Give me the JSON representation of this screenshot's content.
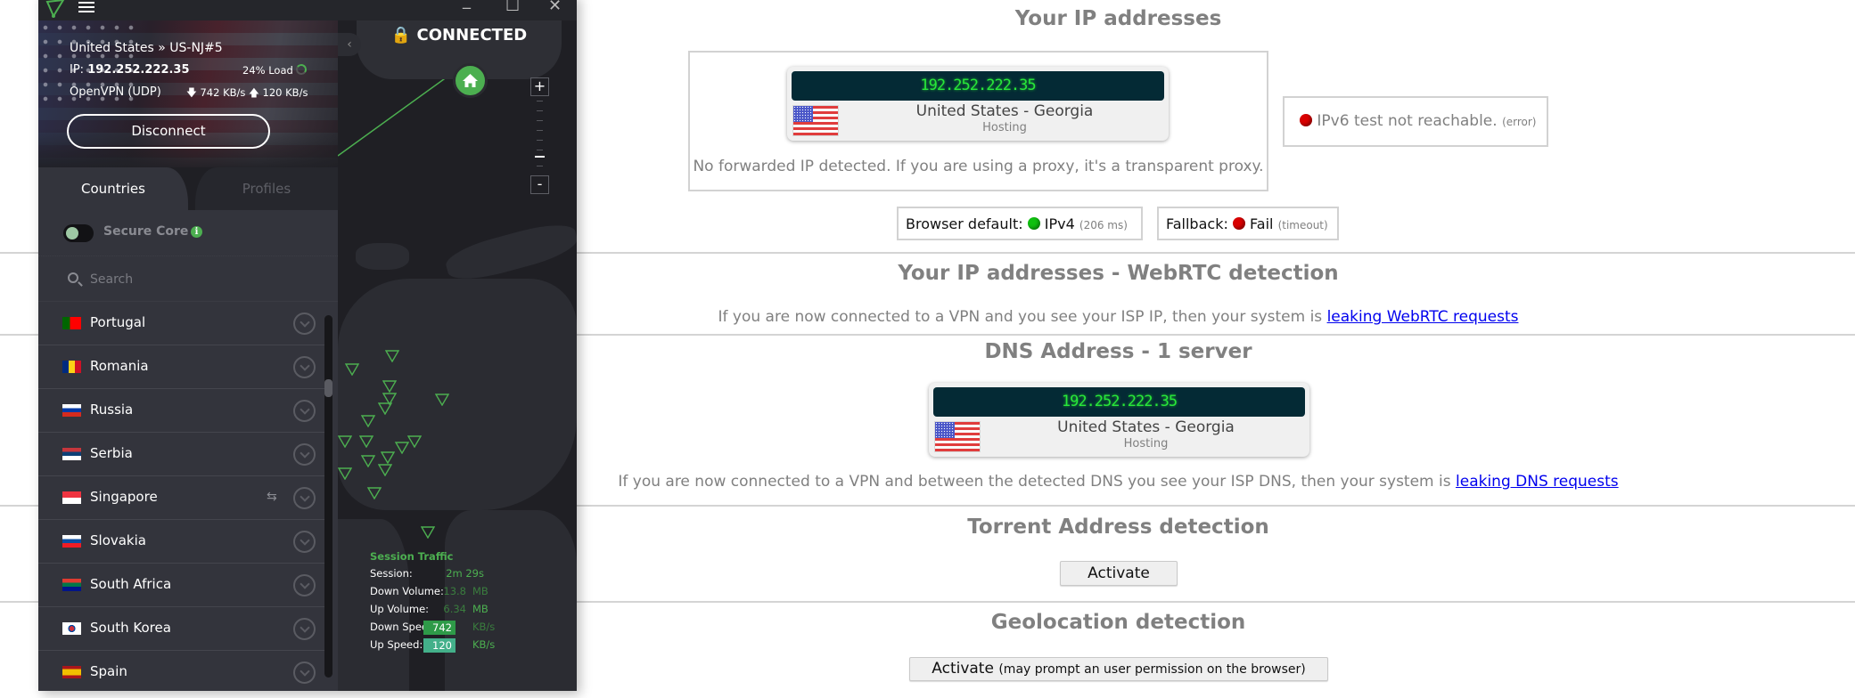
{
  "vpn_app": {
    "window_controls": {
      "minimize": "_",
      "maximize": "☐",
      "close": "✕"
    },
    "connection": {
      "server": "United States » US-NJ#5",
      "ip_label": "IP:",
      "ip": "192.252.222.35",
      "load": "24% Load",
      "load_percent": 24,
      "protocol": "OpenVPN (UDP)",
      "download_speed": "742 KB/s",
      "upload_speed": "120 KB/s",
      "disconnect_label": "Disconnect"
    },
    "status": "CONNECTED",
    "tabs": [
      {
        "label": "Countries",
        "active": true
      },
      {
        "label": "Profiles",
        "active": false
      }
    ],
    "secure_core": {
      "label": "Secure Core",
      "enabled": false,
      "info_glyph": "i"
    },
    "search": {
      "placeholder": "Search",
      "value": ""
    },
    "countries": [
      {
        "name": "Portugal",
        "flag": "portugal-flag",
        "p2p": false
      },
      {
        "name": "Romania",
        "flag": "romania-flag",
        "p2p": false
      },
      {
        "name": "Russia",
        "flag": "russia-flag",
        "p2p": false
      },
      {
        "name": "Serbia",
        "flag": "serbia-flag",
        "p2p": false
      },
      {
        "name": "Singapore",
        "flag": "singapore-flag",
        "p2p": true
      },
      {
        "name": "Slovakia",
        "flag": "slovakia-flag",
        "p2p": false
      },
      {
        "name": "South Africa",
        "flag": "south-africa-flag",
        "p2p": false
      },
      {
        "name": "South Korea",
        "flag": "south-korea-flag",
        "p2p": false
      },
      {
        "name": "Spain",
        "flag": "spain-flag",
        "p2p": false
      }
    ],
    "p2p_glyph": "⇆",
    "collapse_glyph": "‹",
    "zoom": {
      "in": "+",
      "out": "-"
    },
    "session_traffic": {
      "title": "Session Traffic",
      "rows": [
        {
          "label": "Session:",
          "value": "2m 29s",
          "unit": ""
        },
        {
          "label": "Down Volume:",
          "value": "13.8",
          "unit": "MB"
        },
        {
          "label": "Up Volume:",
          "value": "6.34",
          "unit": "MB"
        },
        {
          "label": "Down Speed:",
          "value": "742",
          "unit": "KB/s"
        },
        {
          "label": "Up Speed:",
          "value": "120",
          "unit": "KB/s"
        }
      ]
    },
    "colors": {
      "accent": "#4caf50",
      "background": "#1f1f24",
      "panel": "#33343c"
    }
  },
  "webpage": {
    "ip_section": {
      "title": "Your IP addresses",
      "ip": "192.252.222.35",
      "location": "United States - Georgia",
      "isp_type": "Hosting",
      "forwarded_note": "No forwarded IP detected. If you are using a proxy, it's a transparent proxy.",
      "ipv6": {
        "text": "IPv6 test not reachable.",
        "detail": "(error)",
        "status_color": "#d90000"
      },
      "browser_default": {
        "label": "Browser default:",
        "value": "IPv4",
        "detail": "(206 ms)",
        "status_color": "#10c010"
      },
      "fallback": {
        "label": "Fallback:",
        "value": "Fail",
        "detail": "(timeout)",
        "status_color": "#d90000"
      }
    },
    "webrtc_section": {
      "title": "Your IP addresses - WebRTC detection",
      "note": "If you are now connected to a VPN and you see your ISP IP, then your system is ",
      "link": "leaking WebRTC requests"
    },
    "dns_section": {
      "title": "DNS Address - 1 server",
      "ip": "192.252.222.35",
      "location": "United States - Georgia",
      "isp_type": "Hosting",
      "note": "If you are now connected to a VPN and between the detected DNS you see your ISP DNS, then your system is ",
      "link": "leaking DNS requests"
    },
    "torrent_section": {
      "title": "Torrent Address detection",
      "button": "Activate"
    },
    "geo_section": {
      "title": "Geolocation detection",
      "button": "Activate",
      "button_note": "(may prompt an user permission on the browser)"
    },
    "colors": {
      "ip_display_bg": "#042a35",
      "ip_display_text": "#28e83a",
      "link": "#0000ee",
      "heading": "#808080"
    }
  }
}
